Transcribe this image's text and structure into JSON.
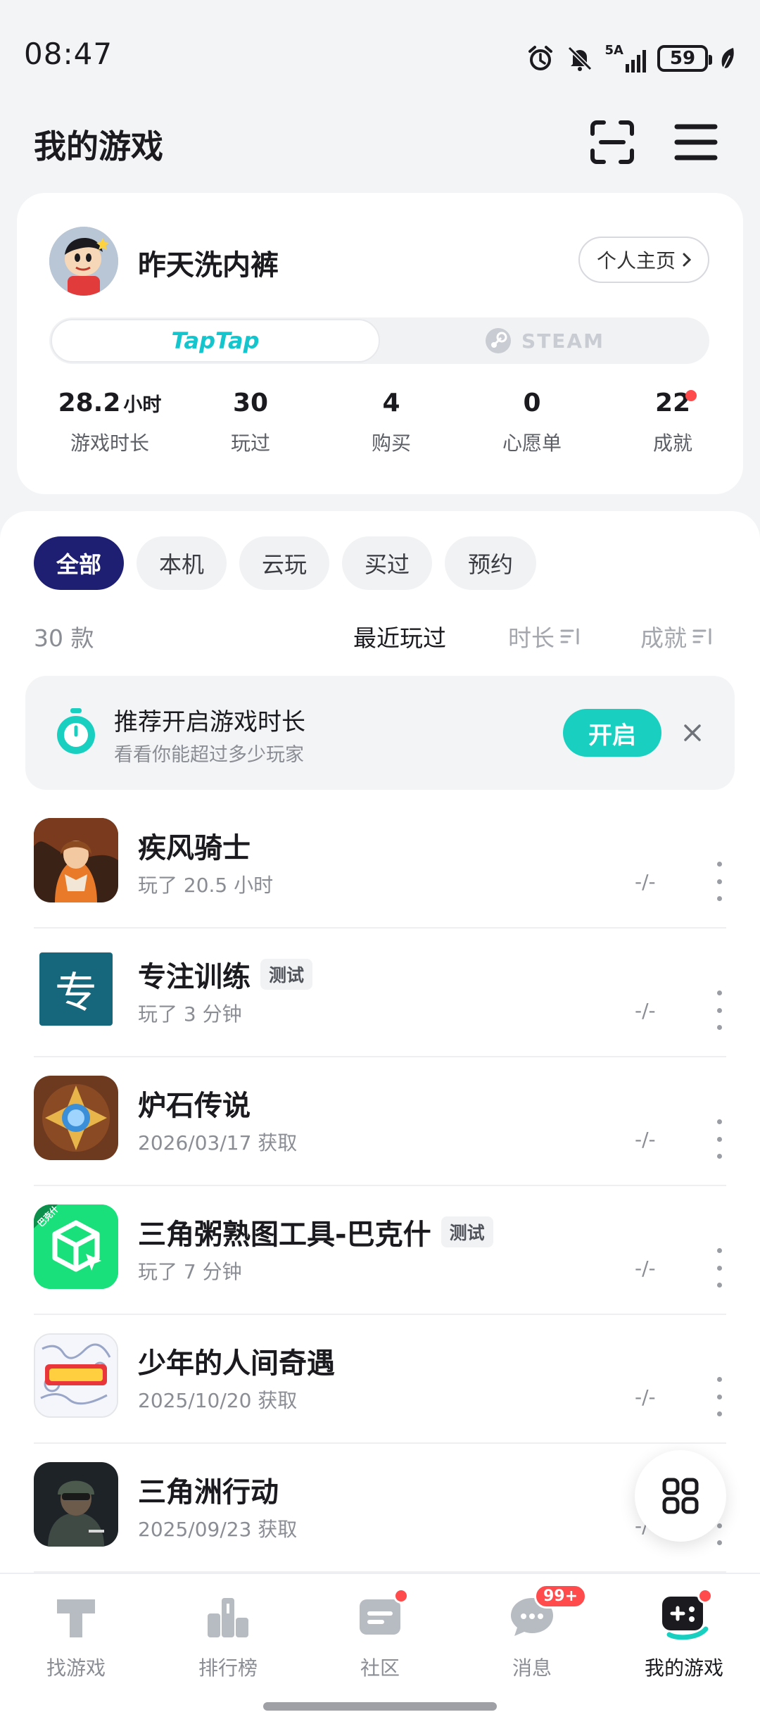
{
  "status_bar": {
    "time": "08:47",
    "network": "5A",
    "battery": "59"
  },
  "header": {
    "title": "我的游戏"
  },
  "profile": {
    "username": "昨天洗内裤",
    "homepage_label": "个人主页",
    "platforms": [
      "TapTap",
      "STEAM"
    ],
    "stats": [
      {
        "value": "28.2",
        "unit": "小时",
        "label": "游戏时长"
      },
      {
        "value": "30",
        "unit": "",
        "label": "玩过"
      },
      {
        "value": "4",
        "unit": "",
        "label": "购买"
      },
      {
        "value": "0",
        "unit": "",
        "label": "心愿单"
      },
      {
        "value": "22",
        "unit": "",
        "label": "成就"
      }
    ]
  },
  "filters": [
    "全部",
    "本机",
    "云玩",
    "买过",
    "预约"
  ],
  "list": {
    "count": "30 款",
    "sorts": [
      "最近玩过",
      "时长",
      "成就"
    ]
  },
  "banner": {
    "title": "推荐开启游戏时长",
    "subtitle": "看看你能超过多少玩家",
    "button": "开启"
  },
  "games": [
    {
      "name": "疾风骑士",
      "tag": "",
      "sub": "玩了 20.5 小时",
      "score": "-/-"
    },
    {
      "name": "专注训练",
      "tag": "测试",
      "sub": "玩了 3 分钟",
      "score": "-/-"
    },
    {
      "name": "炉石传说",
      "tag": "",
      "sub": "2026/03/17 获取",
      "score": "-/-"
    },
    {
      "name": "三角粥熟图工具-巴克什",
      "tag": "测试",
      "sub": "玩了 7 分钟",
      "score": "-/-"
    },
    {
      "name": "少年的人间奇遇",
      "tag": "",
      "sub": "2025/10/20 获取",
      "score": "-/-"
    },
    {
      "name": "三角洲行动",
      "tag": "",
      "sub": "2025/09/23 获取",
      "score": "-/-"
    }
  ],
  "icon_text": {
    "focus": "专",
    "toolbox_corner": "巴克什"
  },
  "bottom_nav": [
    {
      "label": "找游戏",
      "icon": "taptap-icon"
    },
    {
      "label": "排行榜",
      "icon": "ranking-icon"
    },
    {
      "label": "社区",
      "icon": "community-icon"
    },
    {
      "label": "消息",
      "icon": "message-icon",
      "badge": "99+"
    },
    {
      "label": "我的游戏",
      "icon": "my-games-icon"
    }
  ],
  "colors": {
    "accent": "#19d0c0",
    "active_chip": "#1e1f73",
    "badge": "#ff4b4b"
  }
}
